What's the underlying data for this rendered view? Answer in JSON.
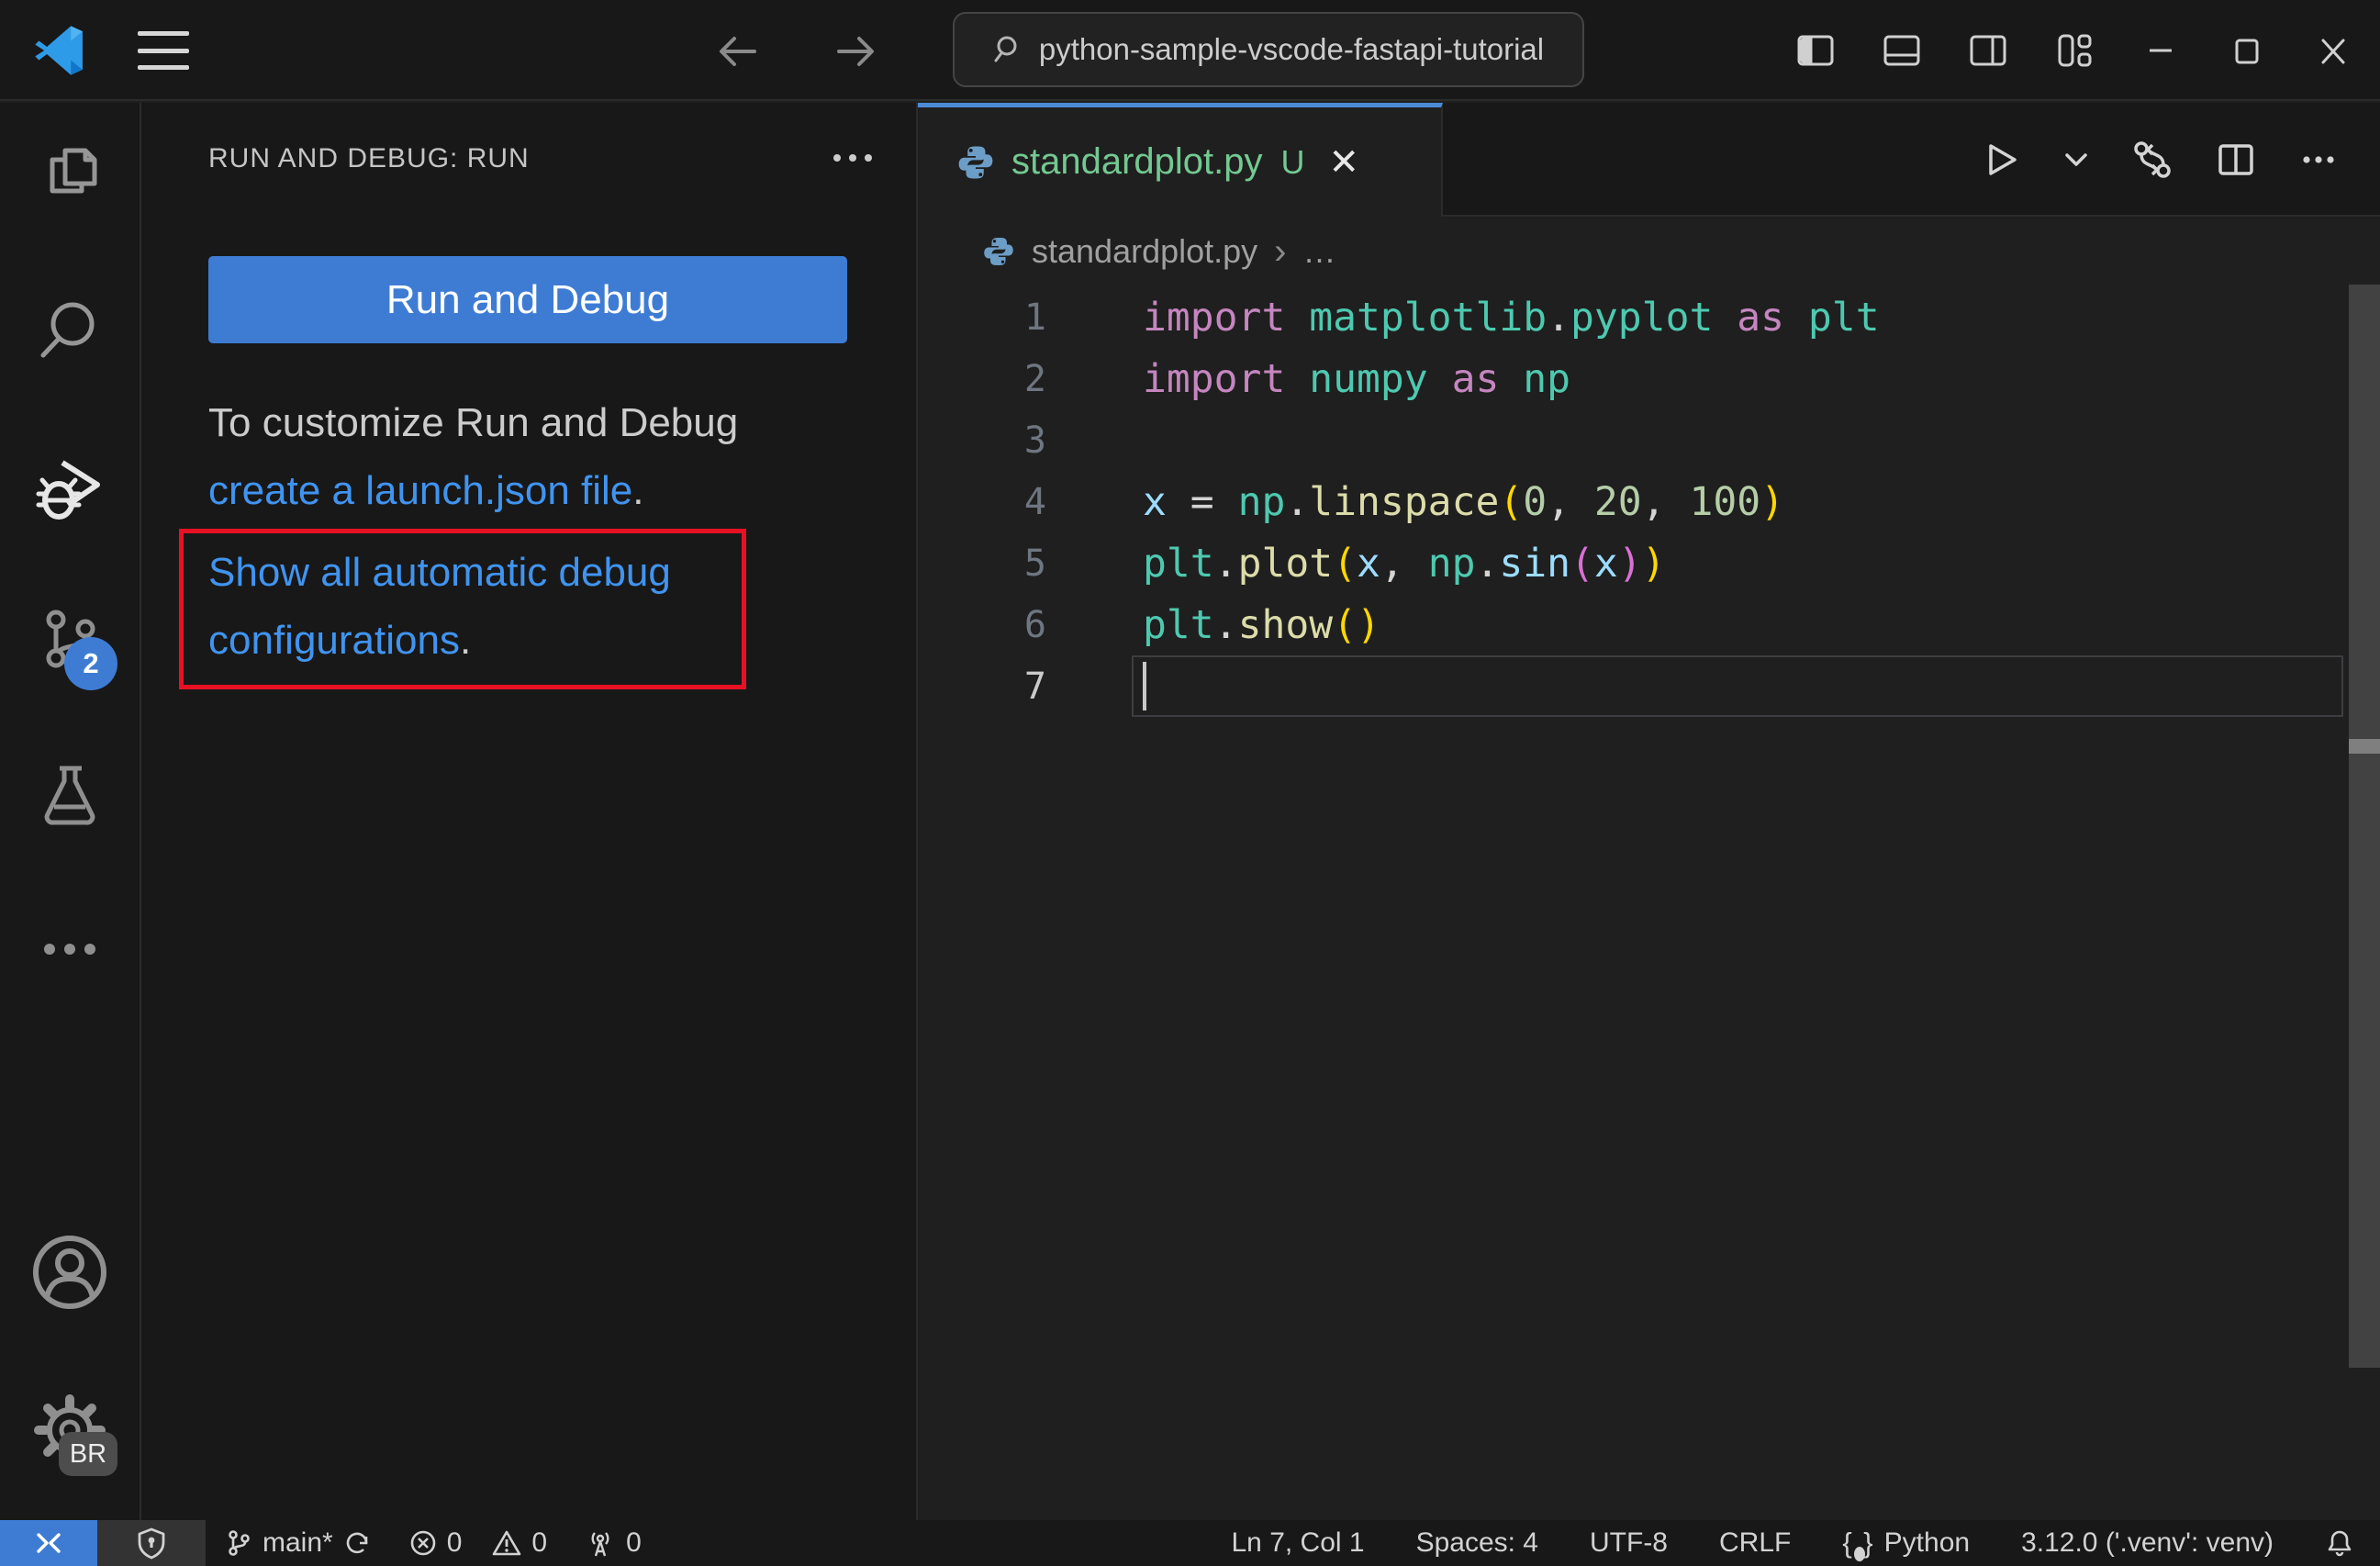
{
  "titlebar": {
    "search_value": "python-sample-vscode-fastapi-tutorial"
  },
  "activity_bar": {
    "source_control_badge": "2",
    "settings_badge": "BR"
  },
  "sidebar": {
    "header": "RUN AND DEBUG: RUN",
    "run_button_label": "Run and Debug",
    "hint_line1": "To customize Run and Debug",
    "hint_link": "create a launch.json file",
    "hint_period": ".",
    "show_link_line1": "Show all automatic debug",
    "show_link_line2": "configurations",
    "show_link_period": "."
  },
  "editor": {
    "tab": {
      "label": "standardplot.py",
      "modifier": "U",
      "close": "✕"
    },
    "breadcrumb": {
      "file": "standardplot.py",
      "separator": "›",
      "more": "…"
    },
    "code": {
      "lines": [
        {
          "num": "1",
          "tokens": [
            [
              "import",
              "kw"
            ],
            [
              " ",
              "fg"
            ],
            [
              "matplotlib",
              "mod"
            ],
            [
              ".",
              "fg"
            ],
            [
              "pyplot",
              "mod"
            ],
            [
              " as ",
              "kw"
            ],
            [
              "plt",
              "mod"
            ]
          ]
        },
        {
          "num": "2",
          "tokens": [
            [
              "import",
              "kw"
            ],
            [
              " ",
              "fg"
            ],
            [
              "numpy",
              "mod"
            ],
            [
              " as ",
              "kw"
            ],
            [
              "np",
              "mod"
            ]
          ]
        },
        {
          "num": "3",
          "tokens": []
        },
        {
          "num": "4",
          "tokens": [
            [
              "x",
              "var"
            ],
            [
              " = ",
              "fg"
            ],
            [
              "np",
              "mod"
            ],
            [
              ".",
              "fg"
            ],
            [
              "linspace",
              "fn"
            ],
            [
              "(",
              "b1"
            ],
            [
              "0",
              "num"
            ],
            [
              ", ",
              "fg"
            ],
            [
              "20",
              "num"
            ],
            [
              ", ",
              "fg"
            ],
            [
              "100",
              "num"
            ],
            [
              ")",
              "b1"
            ]
          ]
        },
        {
          "num": "5",
          "tokens": [
            [
              "plt",
              "mod"
            ],
            [
              ".",
              "fg"
            ],
            [
              "plot",
              "fn"
            ],
            [
              "(",
              "b1"
            ],
            [
              "x",
              "var"
            ],
            [
              ", ",
              "fg"
            ],
            [
              "np",
              "mod"
            ],
            [
              ".",
              "fg"
            ],
            [
              "sin",
              "var"
            ],
            [
              "(",
              "b2"
            ],
            [
              "x",
              "var"
            ],
            [
              ")",
              "b2"
            ],
            [
              ")",
              "b1"
            ]
          ]
        },
        {
          "num": "6",
          "tokens": [
            [
              "plt",
              "mod"
            ],
            [
              ".",
              "fg"
            ],
            [
              "show",
              "fn"
            ],
            [
              "(",
              "b1"
            ],
            [
              ")",
              "b1"
            ]
          ]
        },
        {
          "num": "7",
          "tokens": [],
          "current": true
        }
      ]
    }
  },
  "status_bar": {
    "branch": "main*",
    "errors": "0",
    "warnings": "0",
    "ports": "0",
    "cursor_position": "Ln 7, Col 1",
    "indentation": "Spaces: 4",
    "encoding": "UTF-8",
    "eol": "CRLF",
    "language": "Python",
    "interpreter": "3.12.0 ('.venv': venv)"
  },
  "colors": {
    "bg-editor": "#1f1f1f",
    "bg-chrome": "#181818",
    "border": "#2b2b2b",
    "accent": "#3e7cd4",
    "tabline": "#4b8bd6",
    "link": "#4094f0",
    "red": "#e81123",
    "green": "#73c991",
    "python-icon": "#6c9dc6"
  }
}
